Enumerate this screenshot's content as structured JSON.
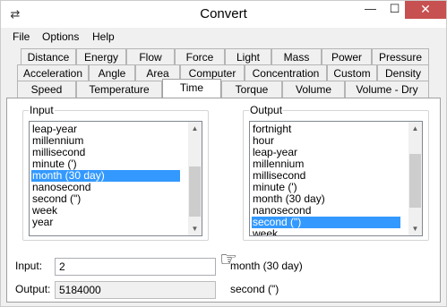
{
  "window": {
    "title": "Convert",
    "minimize_glyph": "—",
    "maximize_glyph": "☐",
    "close_glyph": "✕",
    "icon": "app-icon"
  },
  "menu": [
    "File",
    "Options",
    "Help"
  ],
  "tabs": {
    "row1": [
      "Distance",
      "Energy",
      "Flow",
      "Force",
      "Light",
      "Mass",
      "Power",
      "Pressure"
    ],
    "row2": [
      "Acceleration",
      "Angle",
      "Area",
      "Computer",
      "Concentration",
      "Custom",
      "Density"
    ],
    "row3": [
      "Speed",
      "Temperature",
      "Time",
      "Torque",
      "Volume",
      "Volume - Dry"
    ],
    "active": "Time"
  },
  "input_list": {
    "label": "Input",
    "items": [
      "leap-year",
      "millennium",
      "millisecond",
      "minute (')",
      "month (30 day)",
      "nanosecond",
      "second (\")",
      "week",
      "year"
    ],
    "selected": "month (30 day)"
  },
  "output_list": {
    "label": "Output",
    "items": [
      "fortnight",
      "hour",
      "leap-year",
      "millennium",
      "millisecond",
      "minute (')",
      "month (30 day)",
      "nanosecond",
      "second (\")",
      "week"
    ],
    "selected": "second (\")"
  },
  "pointer_glyph": "☞",
  "input_row": {
    "label": "Input:",
    "value": "2",
    "unit": "month (30 day)"
  },
  "output_row": {
    "label": "Output:",
    "value": "5184000",
    "unit": "second (\")"
  },
  "colors": {
    "selection": "#3399ff",
    "close_button": "#c75050",
    "window_bg": "#f0f0f0"
  }
}
